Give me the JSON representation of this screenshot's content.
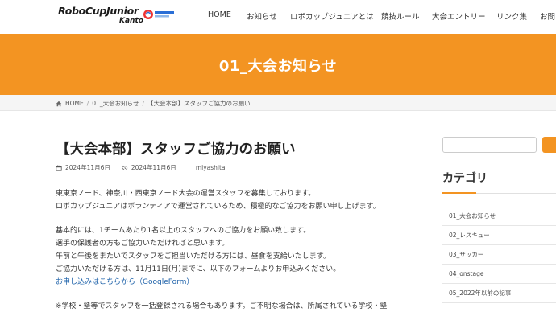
{
  "header": {
    "logo_text": "RoboCupJunior",
    "logo_sub": "Kanto",
    "nav": [
      "HOME",
      "お知らせ",
      "ロボカップジュニアとは",
      "競技ルール",
      "大会エントリー",
      "リンク集",
      "お問い"
    ]
  },
  "banner": {
    "title": "01_大会お知らせ"
  },
  "breadcrumb": {
    "home": "HOME",
    "category": "01_大会お知らせ",
    "current": "【大会本部】スタッフご協力のお願い"
  },
  "article": {
    "title": "【大会本部】スタッフご協力のお願い",
    "published": "2024年11月6日",
    "updated": "2024年11月6日",
    "author": "miyashita",
    "paragraphs": [
      "東東京ノード、神奈川・西東京ノード大会の運営スタッフを募集しております。",
      "ロボカップジュニアはボランティアで運営されているため、積極的なご協力をお願い申し上げます。",
      "基本的には、1チームあたり1名以上のスタッフへのご協力をお願い致します。",
      "選手の保護者の方もご協力いただければと思います。",
      "午前と午後をまたいでスタッフをご担当いただける方には、昼食を支給いたします。",
      "ご協力いただける方は、11月11日(月)までに、以下のフォームよりお申込みください。",
      "お申し込みはこちらから（GoogleForm）",
      "※学校・塾等でスタッフを一括登録される場合もあります。ご不明な場合は、所属されている学校・塾"
    ]
  },
  "sidebar": {
    "heading": "カテゴリ",
    "categories": [
      "01_大会お知らせ",
      "02_レスキュー",
      "03_サッカー",
      "04_onstage",
      "05_2022年以前の記事"
    ]
  },
  "colors": {
    "accent": "#f39422",
    "link": "#1a5fa8"
  }
}
